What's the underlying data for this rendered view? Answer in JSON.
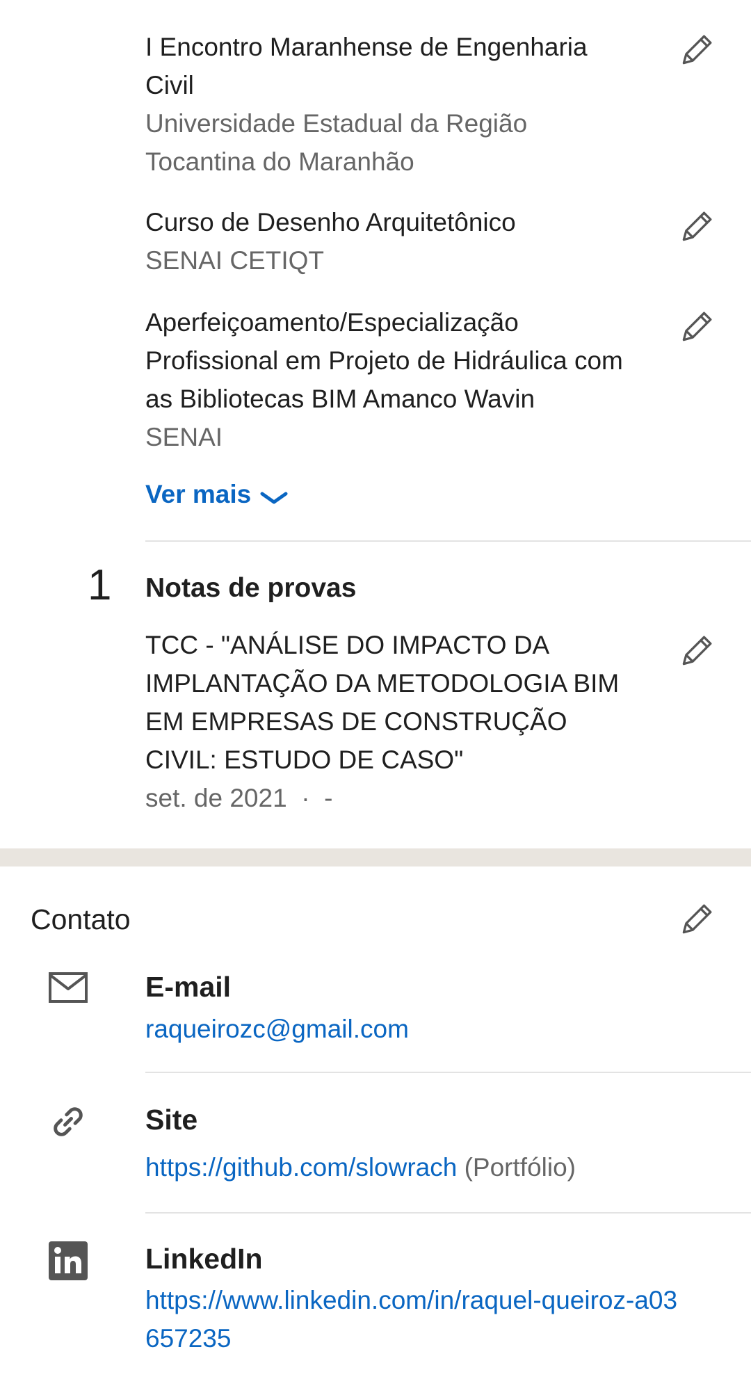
{
  "certificates": {
    "items": [
      {
        "title": "I Encontro Maranhense de Engenharia Civil",
        "issuer": "Universidade Estadual da Região Tocantina do Maranhão"
      },
      {
        "title": "Curso de Desenho Arquitetônico",
        "issuer": "SENAI CETIQT"
      },
      {
        "title": "Aperfeiçoamento/Especialização Profissional em Projeto de Hidráulica com as Bibliotecas BIM Amanco Wavin",
        "issuer": "SENAI"
      }
    ],
    "see_more_label": "Ver mais"
  },
  "test_scores": {
    "count": "1",
    "heading": "Notas de provas",
    "items": [
      {
        "title": "TCC - \"ANÁLISE DO IMPACTO DA IMPLANTAÇÃO DA METODOLOGIA BIM EM EMPRESAS DE CONSTRUÇÃO CIVIL: ESTUDO DE CASO\"",
        "meta": "set. de 2021  ·  -"
      }
    ]
  },
  "contact": {
    "title": "Contato",
    "email": {
      "label": "E-mail",
      "value": "raqueirozc@gmail.com",
      "icon": "mail-icon"
    },
    "site": {
      "label": "Site",
      "value": "https://github.com/slowrach",
      "note": " (Portfólio)",
      "icon": "link-icon"
    },
    "linkedin": {
      "label": "LinkedIn",
      "value": "https://www.linkedin.com/in/raquel-queiroz-a03657235",
      "icon": "linkedin-icon"
    }
  },
  "colors": {
    "link": "#0a66c2",
    "secondary_text": "#666666",
    "band": "#e9e5df"
  }
}
